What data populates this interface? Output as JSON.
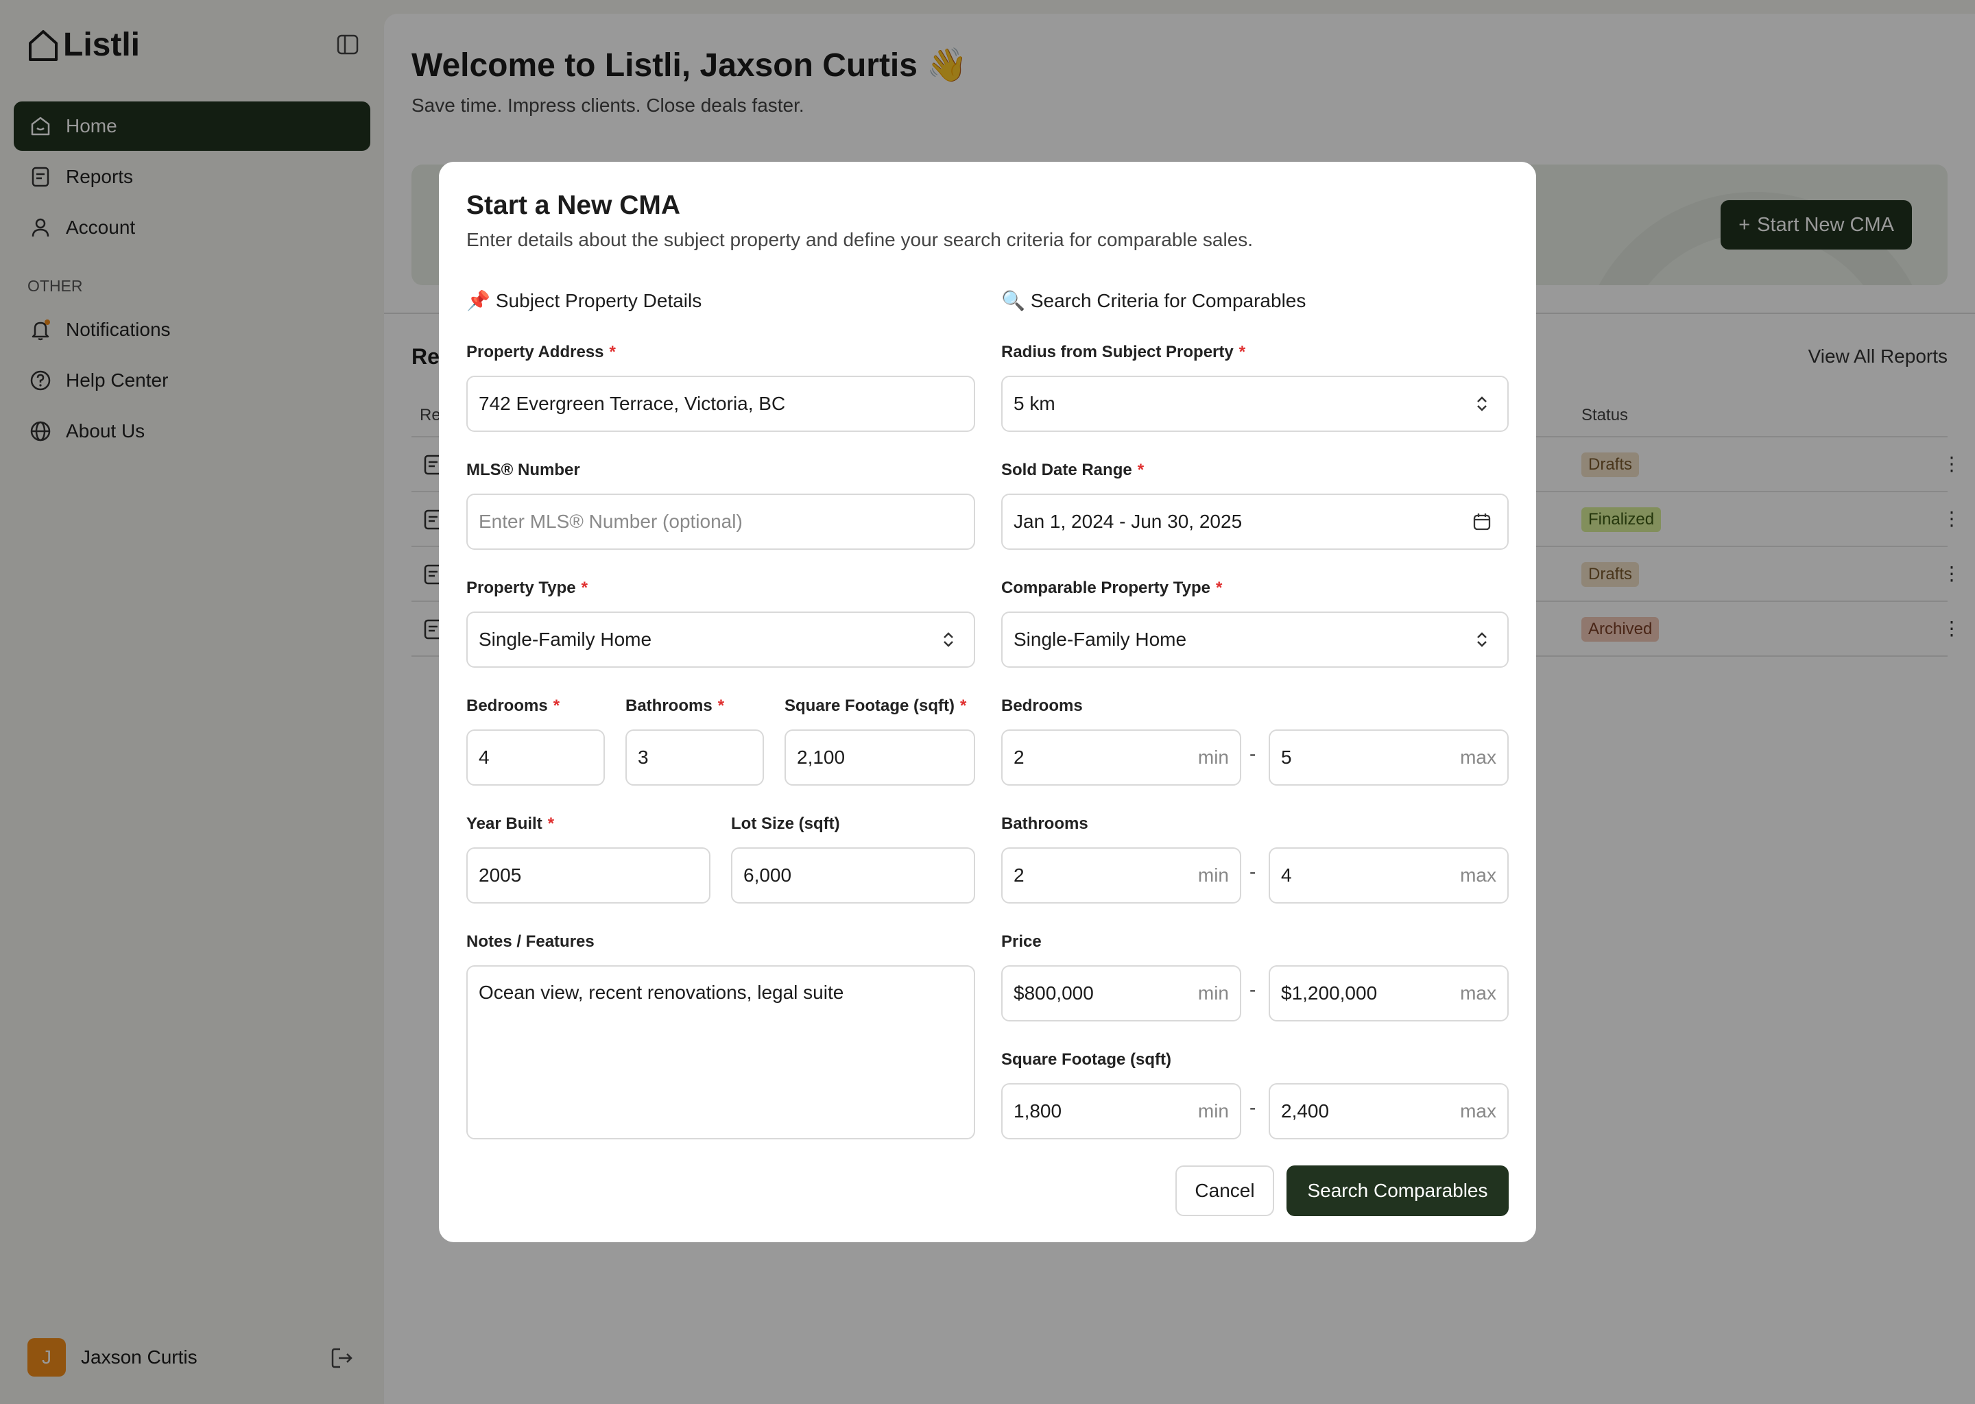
{
  "app": {
    "name": "Listli"
  },
  "sidebar": {
    "items": [
      {
        "label": "Home"
      },
      {
        "label": "Reports"
      },
      {
        "label": "Account"
      }
    ],
    "other_heading": "OTHER",
    "other_items": [
      {
        "label": "Notifications"
      },
      {
        "label": "Help Center"
      },
      {
        "label": "About Us"
      }
    ],
    "user": {
      "initial": "J",
      "name": "Jaxson Curtis"
    }
  },
  "main": {
    "welcome": "Welcome to Listli, Jaxson Curtis 👋",
    "tagline": "Save time. Impress clients. Close deals faster.",
    "start_button": "Start New CMA",
    "recent_title": "Re",
    "view_all": "View All Reports",
    "table": {
      "col_first": "Re",
      "col_status": "Status",
      "rows": [
        {
          "status": "Drafts"
        },
        {
          "status": "Finalized"
        },
        {
          "status": "Drafts"
        },
        {
          "status": "Archived"
        }
      ]
    }
  },
  "colors": {
    "drafts": "#f0dfc6",
    "finalized": "#d9ee9a",
    "archived": "#f1c9b8",
    "accent": "#21331f"
  },
  "modal": {
    "title": "Start a New CMA",
    "subtitle": "Enter details about the subject property and define your search criteria for comparable sales.",
    "left_section": "Subject Property Details",
    "right_section": "Search Criteria for Comparables",
    "property_address": {
      "label": "Property Address",
      "value": "742 Evergreen Terrace, Victoria, BC"
    },
    "mls": {
      "label": "MLS® Number",
      "placeholder": "Enter MLS® Number (optional)"
    },
    "property_type": {
      "label": "Property Type",
      "value": "Single-Family Home"
    },
    "bedrooms": {
      "label": "Bedrooms",
      "value": "4"
    },
    "bathrooms": {
      "label": "Bathrooms",
      "value": "3"
    },
    "sqft": {
      "label": "Square Footage (sqft)",
      "value": "2,100"
    },
    "year_built": {
      "label": "Year Built",
      "value": "2005"
    },
    "lot_size": {
      "label": "Lot Size (sqft)",
      "value": "6,000"
    },
    "notes": {
      "label": "Notes / Features",
      "value": "Ocean view, recent renovations, legal suite"
    },
    "radius": {
      "label": "Radius from Subject Property",
      "value": "5 km"
    },
    "sold_range": {
      "label": "Sold Date Range",
      "value": "Jan 1, 2024 - Jun 30, 2025"
    },
    "comp_type": {
      "label": "Comparable Property Type",
      "value": "Single-Family Home"
    },
    "c_bedrooms": {
      "label": "Bedrooms",
      "min": "2",
      "max": "5"
    },
    "c_bathrooms": {
      "label": "Bathrooms",
      "min": "2",
      "max": "4"
    },
    "c_price": {
      "label": "Price",
      "min": "$800,000",
      "max": "$1,200,000"
    },
    "c_sqft": {
      "label": "Square Footage (sqft)",
      "min": "1,800",
      "max": "2,400"
    },
    "min_text": "min",
    "max_text": "max",
    "range_sep": "-",
    "required_mark": "*",
    "cancel": "Cancel",
    "search": "Search Comparables"
  }
}
